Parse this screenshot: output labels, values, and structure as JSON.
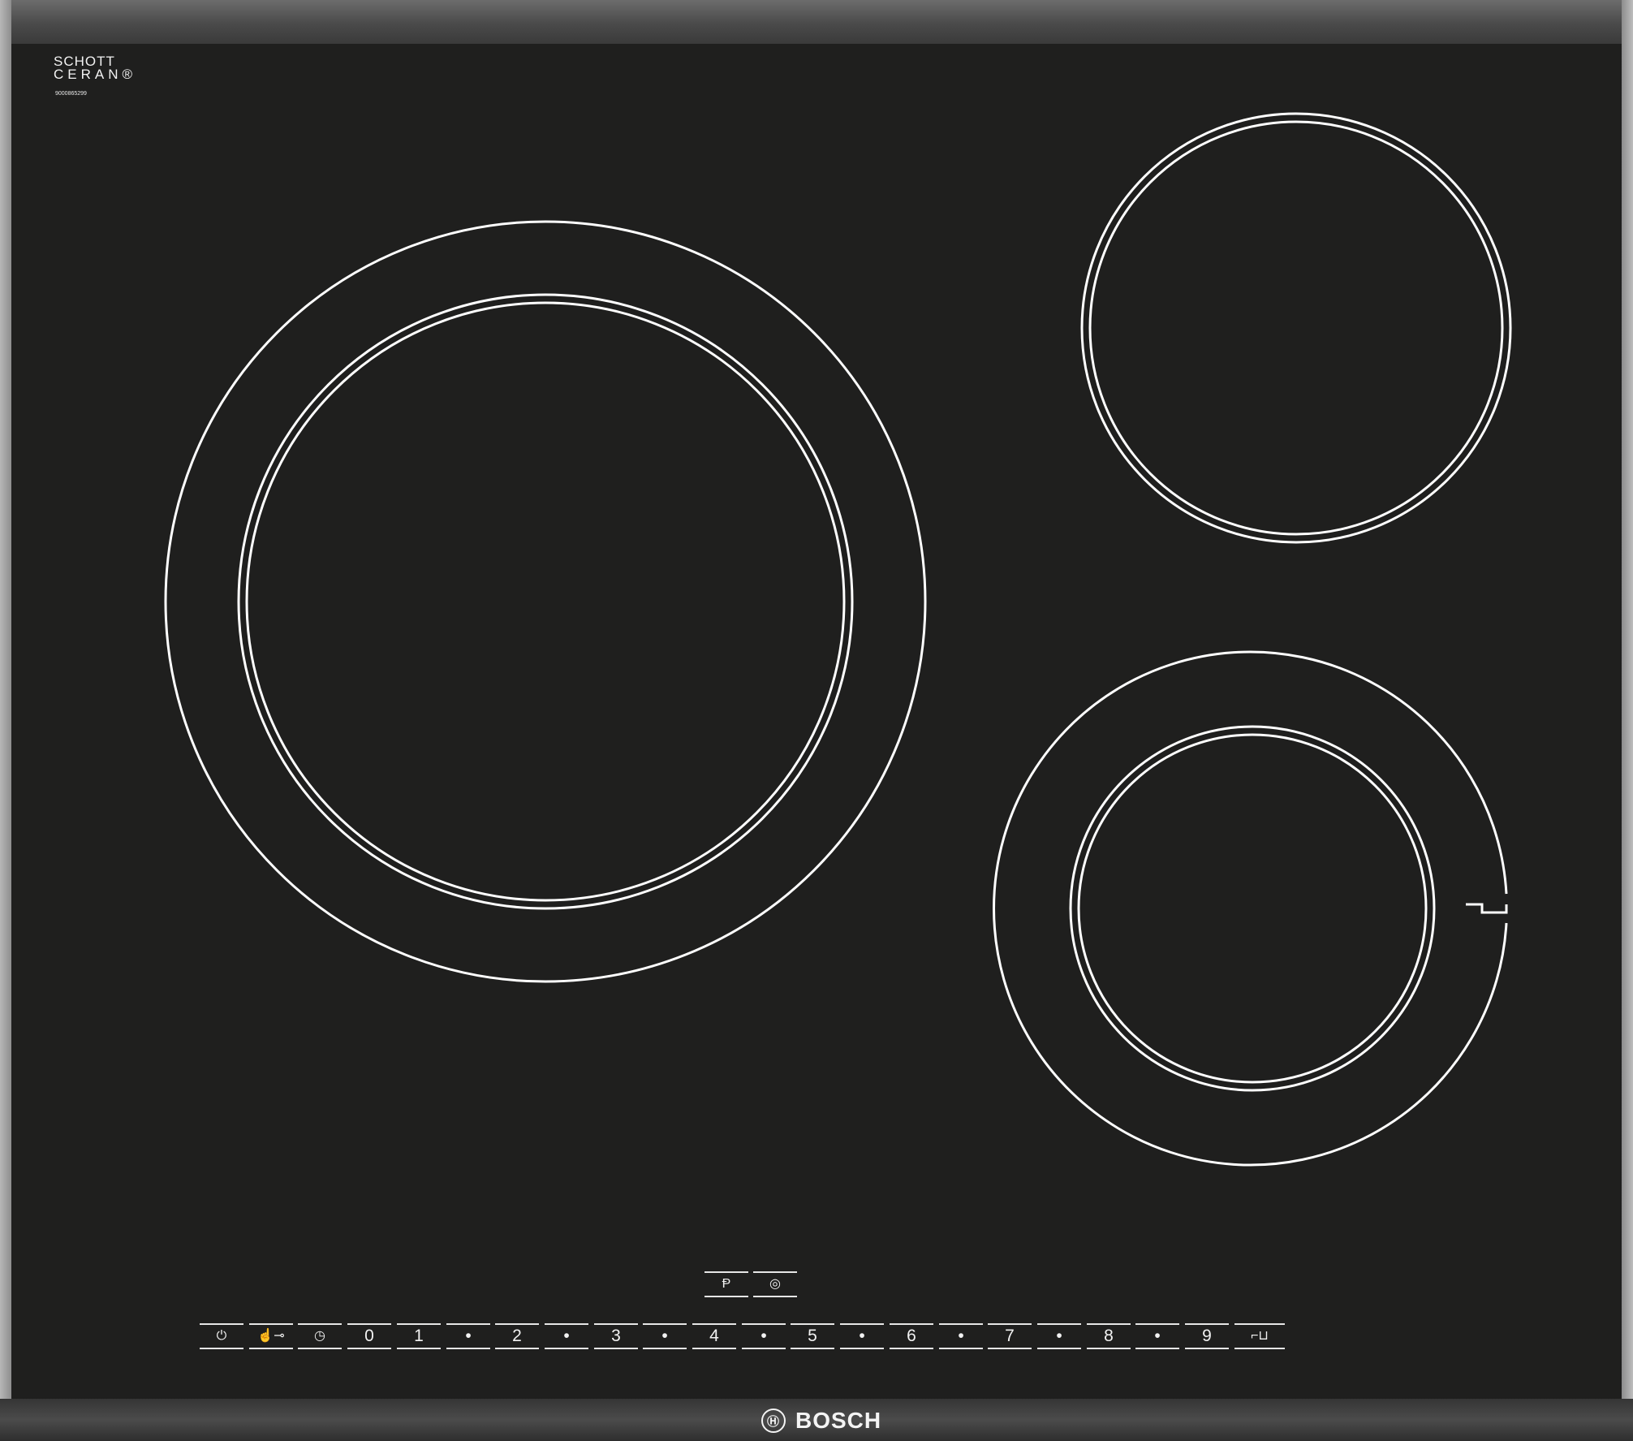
{
  "brand": {
    "glass_logo_line1": "SCHOTT",
    "glass_logo_line2": "CERAN®",
    "serial_number": "9000865299",
    "maker": "BOSCH",
    "maker_mark": "Ⓗ"
  },
  "upper_controls": [
    {
      "name": "power-boost-button",
      "glyph": "Ᵽ"
    },
    {
      "name": "zone-select-button",
      "glyph": "◎"
    }
  ],
  "control_strip": [
    {
      "name": "power-switch-button",
      "glyph": "⏻"
    },
    {
      "name": "child-lock-button",
      "glyph": "☝⊸"
    },
    {
      "name": "timer-button",
      "glyph": "◷"
    },
    {
      "name": "power-level-0",
      "glyph": "0"
    },
    {
      "name": "power-level-1",
      "glyph": "1"
    },
    {
      "name": "power-level-1-5",
      "glyph": "•"
    },
    {
      "name": "power-level-2",
      "glyph": "2"
    },
    {
      "name": "power-level-2-5",
      "glyph": "•"
    },
    {
      "name": "power-level-3",
      "glyph": "3"
    },
    {
      "name": "power-level-3-5",
      "glyph": "•"
    },
    {
      "name": "power-level-4",
      "glyph": "4"
    },
    {
      "name": "power-level-4-5",
      "glyph": "•"
    },
    {
      "name": "power-level-5",
      "glyph": "5"
    },
    {
      "name": "power-level-5-5",
      "glyph": "•"
    },
    {
      "name": "power-level-6",
      "glyph": "6"
    },
    {
      "name": "power-level-6-5",
      "glyph": "•"
    },
    {
      "name": "power-level-7",
      "glyph": "7"
    },
    {
      "name": "power-level-7-5",
      "glyph": "•"
    },
    {
      "name": "power-level-8",
      "glyph": "8"
    },
    {
      "name": "power-level-8-5",
      "glyph": "•"
    },
    {
      "name": "power-level-9",
      "glyph": "9"
    },
    {
      "name": "roaster-zone-button",
      "glyph": "⌐⊔"
    }
  ]
}
